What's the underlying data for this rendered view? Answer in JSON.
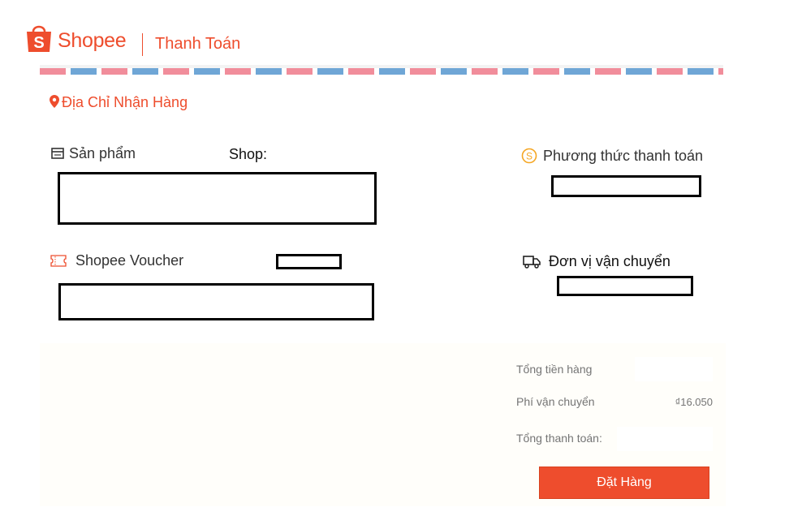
{
  "header": {
    "brand": "Shopee",
    "page_title": "Thanh Toán"
  },
  "address": {
    "label": "Địa Chỉ Nhận Hàng"
  },
  "products": {
    "label": "Sản phẩm",
    "shop_label": "Shop:"
  },
  "voucher": {
    "label": "Shopee Voucher"
  },
  "payment": {
    "label": "Phương thức thanh toán"
  },
  "shipping": {
    "label": "Đơn vị vận chuyển"
  },
  "summary": {
    "subtotal_label": "Tổng tiền hàng",
    "shipping_fee_label": "Phí vận chuyển",
    "shipping_fee_value": "₫16.050",
    "total_label": "Tổng thanh toán:"
  },
  "order_button": {
    "label": "Đặt Hàng"
  },
  "colors": {
    "brand": "#ee4d2d",
    "payment_icon": "#f5a623",
    "stripe_red": "#f18d9b",
    "stripe_blue": "#6fa6d6"
  },
  "icons": [
    "shopee-bag-logo",
    "location-pin-icon",
    "product-box-icon",
    "voucher-ticket-icon",
    "coin-icon",
    "truck-icon"
  ]
}
